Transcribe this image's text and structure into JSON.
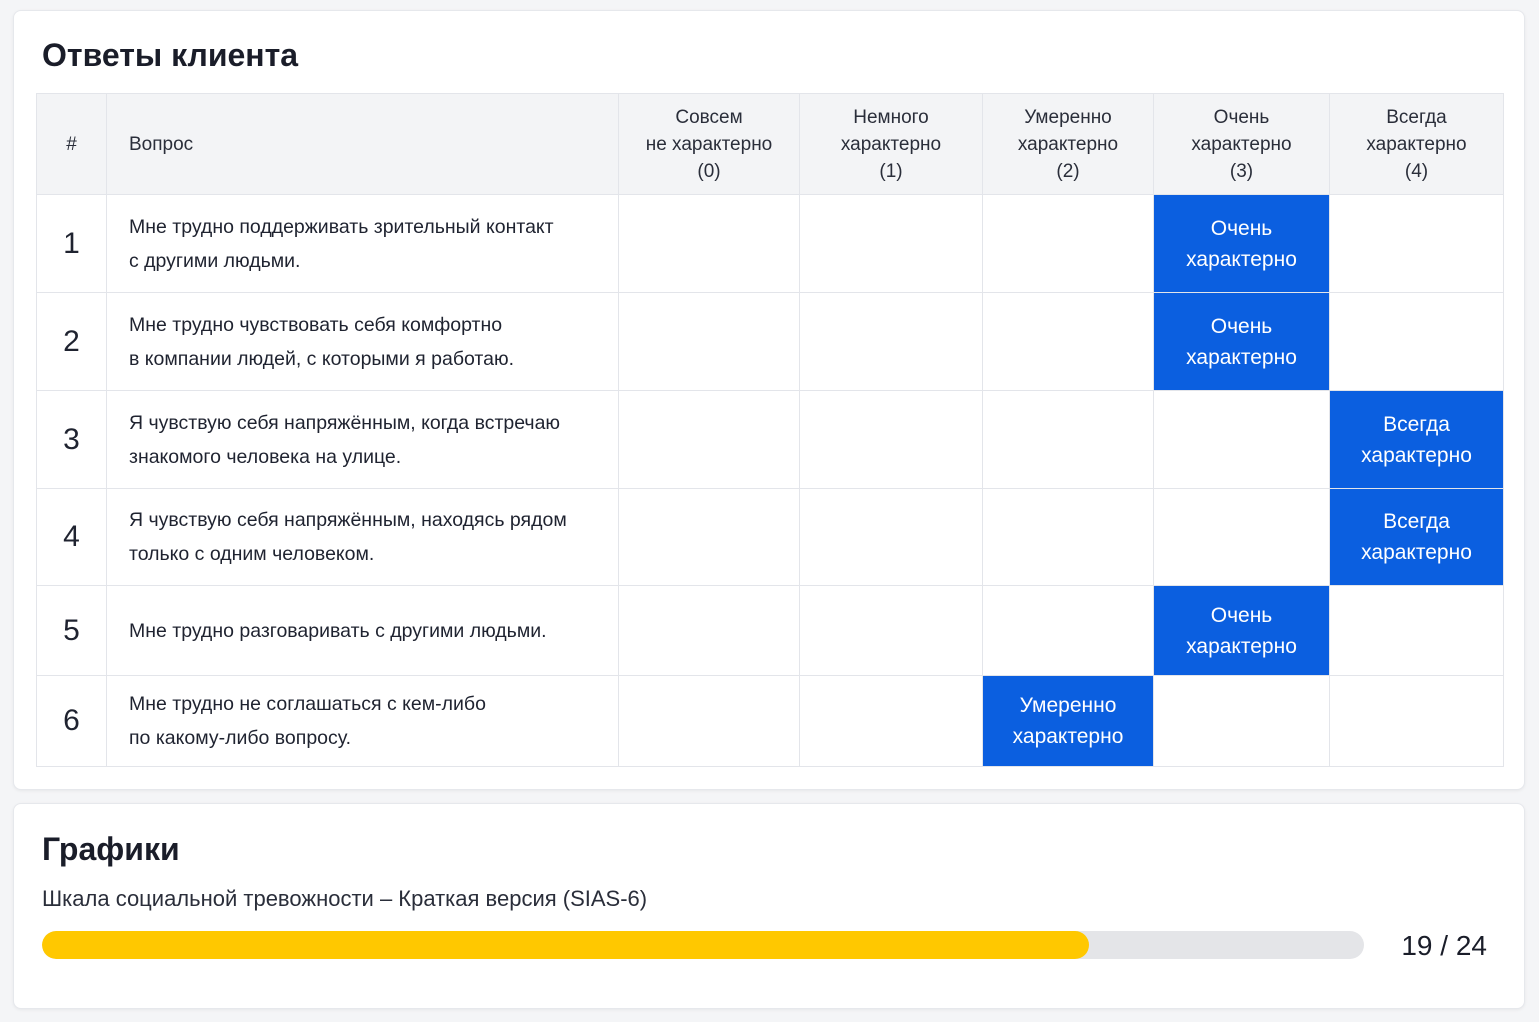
{
  "answers": {
    "title": "Ответы клиента",
    "headers": {
      "num": "#",
      "question": "Вопрос",
      "options": [
        {
          "l1": "Совсем",
          "l2": "не характерно",
          "l3": "(0)"
        },
        {
          "l1": "Немного",
          "l2": "характерно",
          "l3": "(1)"
        },
        {
          "l1": "Умеренно",
          "l2": "характерно",
          "l3": "(2)"
        },
        {
          "l1": "Очень",
          "l2": "характерно",
          "l3": "(3)"
        },
        {
          "l1": "Всегда",
          "l2": "характерно",
          "l3": "(4)"
        }
      ]
    },
    "rows": [
      {
        "num": "1",
        "q1": "Мне трудно поддерживать зрительный контакт",
        "q2": "с другими людьми.",
        "selected": 3,
        "a1": "Очень",
        "a2": "характерно"
      },
      {
        "num": "2",
        "q1": "Мне трудно чувствовать себя комфортно",
        "q2": "в компании людей, с которыми я работаю.",
        "selected": 3,
        "a1": "Очень",
        "a2": "характерно"
      },
      {
        "num": "3",
        "q1": "Я чувствую себя напряжённым, когда встречаю",
        "q2": "знакомого человека на улице.",
        "selected": 4,
        "a1": "Всегда",
        "a2": "характерно"
      },
      {
        "num": "4",
        "q1": "Я чувствую себя напряжённым, находясь рядом",
        "q2": "только с одним человеком.",
        "selected": 4,
        "a1": "Всегда",
        "a2": "характерно"
      },
      {
        "num": "5",
        "q1": "Мне трудно разговаривать с другими людьми.",
        "q2": "",
        "selected": 3,
        "a1": "Очень",
        "a2": "характерно"
      },
      {
        "num": "6",
        "q1": "Мне трудно не соглашаться с кем-либо",
        "q2": "по какому-либо вопросу.",
        "selected": 2,
        "a1": "Умеренно",
        "a2": "характерно"
      }
    ]
  },
  "charts": {
    "title": "Графики",
    "scale_name": "Шкала социальной тревожности – Краткая версия (SIAS-6)",
    "score": 19,
    "max": 24,
    "score_text": "19 / 24",
    "colors": {
      "fill": "#ffc800",
      "track": "#e4e5e8",
      "selected_cell": "#0b5fe0"
    }
  }
}
